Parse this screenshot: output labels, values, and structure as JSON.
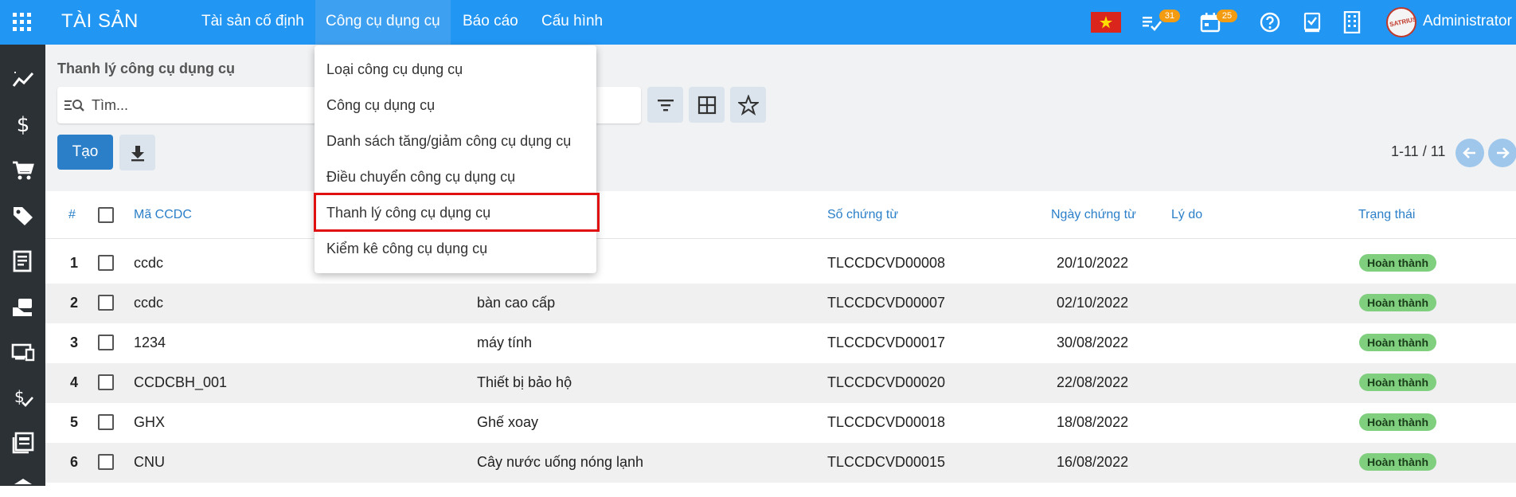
{
  "app": {
    "brand": "TÀI SẢN"
  },
  "nav": {
    "items": [
      {
        "label": "Tài sản cố định"
      },
      {
        "label": "Công cụ dụng cụ"
      },
      {
        "label": "Báo cáo"
      },
      {
        "label": "Cấu hình"
      }
    ]
  },
  "topbar": {
    "tasks_badge": "31",
    "calendar_badge": "25",
    "user_name": "Administrator",
    "avatar_text": "SATRIUS"
  },
  "sidebar": {
    "icons": [
      "trend-icon",
      "dollar-icon",
      "cart-icon",
      "tag-icon",
      "report-icon",
      "hand-coin-icon",
      "devices-icon",
      "dollar-check-icon",
      "newspaper-icon",
      "more-icon"
    ]
  },
  "control": {
    "breadcrumb": "Thanh lý công cụ dụng cụ",
    "search_placeholder": "Tìm...",
    "create_label": "Tạo",
    "pager": "1-11 / 11"
  },
  "table": {
    "headers": {
      "num": "#",
      "code": "Mã CCDC",
      "doc_no": "Số chứng từ",
      "doc_date": "Ngày chứng từ",
      "reason": "Lý do",
      "status": "Trạng thái"
    },
    "rows": [
      {
        "num": "1",
        "code": "ccdc",
        "name": "",
        "doc_no": "TLCCDCVD00008",
        "doc_date": "20/10/2022",
        "status": "Hoàn thành"
      },
      {
        "num": "2",
        "code": "ccdc",
        "name": "bàn cao cấp",
        "doc_no": "TLCCDCVD00007",
        "doc_date": "02/10/2022",
        "status": "Hoàn thành"
      },
      {
        "num": "3",
        "code": "1234",
        "name": "máy tính",
        "doc_no": "TLCCDCVD00017",
        "doc_date": "30/08/2022",
        "status": "Hoàn thành"
      },
      {
        "num": "4",
        "code": "CCDCBH_001",
        "name": "Thiết bị bảo hộ",
        "doc_no": "TLCCDCVD00020",
        "doc_date": "22/08/2022",
        "status": "Hoàn thành"
      },
      {
        "num": "5",
        "code": "GHX",
        "name": "Ghế xoay",
        "doc_no": "TLCCDCVD00018",
        "doc_date": "18/08/2022",
        "status": "Hoàn thành"
      },
      {
        "num": "6",
        "code": "CNU",
        "name": "Cây nước uống nóng lạnh",
        "doc_no": "TLCCDCVD00015",
        "doc_date": "16/08/2022",
        "status": "Hoàn thành"
      }
    ]
  },
  "dropdown": {
    "items": [
      {
        "label": "Loại công cụ dụng cụ"
      },
      {
        "label": "Công cụ dụng cụ"
      },
      {
        "label": "Danh sách tăng/giảm công cụ dụng cụ"
      },
      {
        "label": "Điều chuyển công cụ dụng cụ"
      },
      {
        "label": "Thanh lý công cụ dụng cụ"
      },
      {
        "label": "Kiểm kê công cụ dụng cụ"
      }
    ]
  },
  "colors": {
    "topbar": "#2196f3",
    "sidebar": "#2c3136",
    "accent": "#2b7fc8",
    "status_done": "#7fcf7f",
    "highlight": "#e01010"
  }
}
